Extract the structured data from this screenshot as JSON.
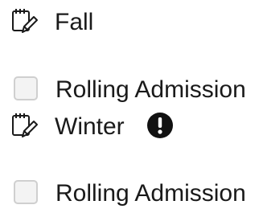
{
  "terms": [
    {
      "icon": "notepad-edit-icon",
      "label": "Fall",
      "option_label": "Rolling Admission",
      "option_checked": false,
      "alert": false
    },
    {
      "icon": "notepad-edit-icon",
      "label": "Winter",
      "option_label": "Rolling Admission",
      "option_checked": false,
      "alert": true,
      "alert_icon": "exclamation-circle-icon"
    }
  ],
  "colors": {
    "text": "#1a1a1a",
    "checkbox_border": "#cfcfcf",
    "checkbox_fill": "#f3f3f3",
    "alert": "#111111"
  }
}
